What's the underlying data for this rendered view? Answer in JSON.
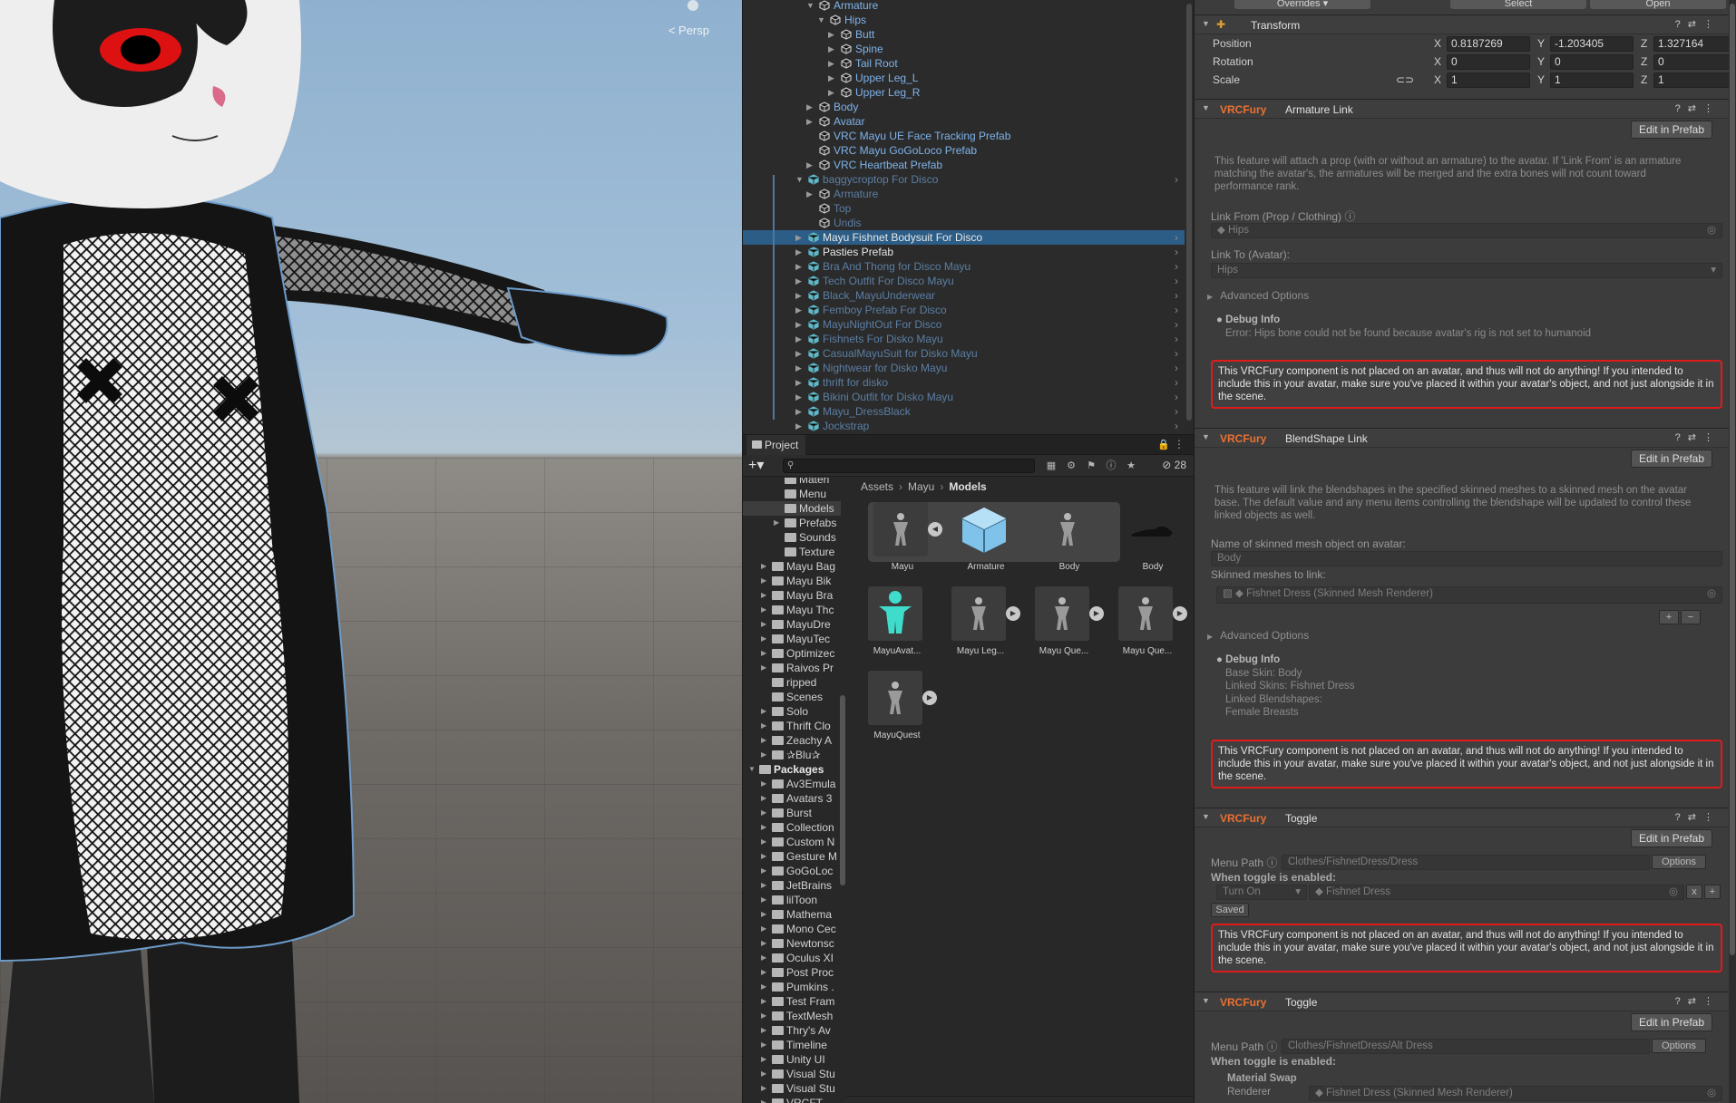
{
  "scene": {
    "camera_mode": "Persp"
  },
  "hierarchy": {
    "rows": [
      {
        "label": "Armature",
        "color": "blue"
      },
      {
        "label": "Hips",
        "color": "blue"
      },
      {
        "label": "Butt",
        "color": "blue"
      },
      {
        "label": "Spine",
        "color": "blue"
      },
      {
        "label": "Tail Root",
        "color": "blue"
      },
      {
        "label": "Upper Leg_L",
        "color": "blue"
      },
      {
        "label": "Upper Leg_R",
        "color": "blue"
      },
      {
        "label": "Body",
        "color": "blue"
      },
      {
        "label": "Avatar",
        "color": "blue"
      },
      {
        "label": "VRC Mayu UE Face Tracking Prefab",
        "color": "blue"
      },
      {
        "label": "VRC Mayu GoGoLoco Prefab",
        "color": "blue"
      },
      {
        "label": "VRC Heartbeat Prefab",
        "color": "blue"
      },
      {
        "label": "baggycroptop For Disco",
        "color": "faded"
      },
      {
        "label": "Armature",
        "color": "faded"
      },
      {
        "label": "Top",
        "color": "faded"
      },
      {
        "label": "Undis",
        "color": "faded"
      },
      {
        "label": "Mayu Fishnet Bodysuit For Disco",
        "color": "white"
      },
      {
        "label": "Pasties Prefab",
        "color": "white"
      },
      {
        "label": "Bra And Thong for Disco Mayu",
        "color": "faded"
      },
      {
        "label": "Tech Outfit For Disco Mayu",
        "color": "faded"
      },
      {
        "label": "Black_MayuUnderwear",
        "color": "faded"
      },
      {
        "label": "Femboy Prefab For Disco",
        "color": "faded"
      },
      {
        "label": "MayuNightOut For Disco",
        "color": "faded"
      },
      {
        "label": "Fishnets For Disko Mayu",
        "color": "faded"
      },
      {
        "label": "CasualMayuSuit for Disko Mayu",
        "color": "faded"
      },
      {
        "label": "Nightwear for Disko Mayu",
        "color": "faded"
      },
      {
        "label": "thrift for disko",
        "color": "faded"
      },
      {
        "label": "Bikini Outfit for Disko Mayu",
        "color": "faded"
      },
      {
        "label": "Mayu_DressBlack",
        "color": "faded"
      },
      {
        "label": "Jockstrap",
        "color": "faded"
      }
    ]
  },
  "project": {
    "tab_label": "Project",
    "hidden_count": "28",
    "breadcrumb": [
      "Assets",
      "Mayu",
      "Models"
    ],
    "tree": [
      {
        "label": "Materi"
      },
      {
        "label": "Menu"
      },
      {
        "label": "Models"
      },
      {
        "label": "Prefabs"
      },
      {
        "label": "Sounds"
      },
      {
        "label": "Texture"
      },
      {
        "label": "Mayu Bag"
      },
      {
        "label": "Mayu Bik"
      },
      {
        "label": "Mayu Bra"
      },
      {
        "label": "Mayu Thc"
      },
      {
        "label": "MayuDre"
      },
      {
        "label": "MayuTec"
      },
      {
        "label": "Optimizec"
      },
      {
        "label": "Raivos Pr"
      },
      {
        "label": "ripped"
      },
      {
        "label": "Scenes"
      },
      {
        "label": "Solo"
      },
      {
        "label": "Thrift Clo"
      },
      {
        "label": "Zeachy A"
      },
      {
        "label": "✰Blu✰"
      },
      {
        "label": "Packages"
      },
      {
        "label": "Av3Emula"
      },
      {
        "label": "Avatars 3"
      },
      {
        "label": "Burst"
      },
      {
        "label": "Collection"
      },
      {
        "label": "Custom N"
      },
      {
        "label": "Gesture M"
      },
      {
        "label": "GoGoLoc"
      },
      {
        "label": "JetBrains"
      },
      {
        "label": "lilToon"
      },
      {
        "label": "Mathema"
      },
      {
        "label": "Mono Cec"
      },
      {
        "label": "Newtonsc"
      },
      {
        "label": "Oculus XI"
      },
      {
        "label": "Post Proc"
      },
      {
        "label": "Pumkins ."
      },
      {
        "label": "Test Fram"
      },
      {
        "label": "TextMesh"
      },
      {
        "label": "Thry's Av"
      },
      {
        "label": "Timeline"
      },
      {
        "label": "Unity UI"
      },
      {
        "label": "Visual Stu"
      },
      {
        "label": "Visual Stu"
      },
      {
        "label": "VRCFT -"
      }
    ],
    "assets": [
      {
        "name": "Mayu",
        "kind": "model"
      },
      {
        "name": "Armature",
        "kind": "prefab"
      },
      {
        "name": "Body",
        "kind": "model"
      },
      {
        "name": "Body",
        "kind": "mesh"
      },
      {
        "name": "MayuAvat...",
        "kind": "avatar"
      },
      {
        "name": "Mayu Leg...",
        "kind": "model"
      },
      {
        "name": "Mayu Que...",
        "kind": "model"
      },
      {
        "name": "Mayu Que...",
        "kind": "model"
      },
      {
        "name": "MayuQuest",
        "kind": "model"
      }
    ]
  },
  "inspector": {
    "top_buttons": [
      "Overrides",
      "Select",
      "Open"
    ],
    "transform": {
      "title": "Transform",
      "position_label": "Position",
      "rotation_label": "Rotation",
      "scale_label": "Scale",
      "axis_x": "X",
      "axis_y": "Y",
      "axis_z": "Z",
      "position": [
        "0.8187269",
        "-1.203405",
        "1.327164"
      ],
      "rotation": [
        "0",
        "0",
        "0"
      ],
      "scale": [
        "1",
        "1",
        "1"
      ]
    },
    "brand": "VRCFury",
    "edit_in_prefab": "Edit in Prefab",
    "warning_text": "This VRCFury component is not placed on an avatar, and thus will not do anything! If you intended to include this in your avatar, make sure you've placed it within your avatar's object, and not just alongside it in the scene.",
    "advanced_options": "Advanced Options",
    "debug_info": "Debug Info",
    "armature_link": {
      "title": "Armature Link",
      "description": "This feature will attach a prop (with or without an armature) to the avatar. If 'Link From' is an armature matching the avatar's, the armatures will be merged and the extra bones will not count toward performance rank.",
      "link_from_label": "Link From (Prop / Clothing)",
      "link_from_value": "Hips",
      "link_to_label": "Link To (Avatar):",
      "link_to_value": "Hips",
      "debug_text": "Error: Hips bone could not be found because avatar's rig is not set to humanoid"
    },
    "blendshape_link": {
      "title": "BlendShape Link",
      "description": "This feature will link the blendshapes in the specified skinned meshes to a skinned mesh on the avatar base. The default value and any menu items controlling the blendshape will be updated to control these linked objects as well.",
      "mesh_name_label": "Name of skinned mesh object on avatar:",
      "mesh_name_value": "Body",
      "meshes_label": "Skinned meshes to link:",
      "mesh_item": "Fishnet Dress (Skinned Mesh Renderer)",
      "debug_lines": [
        "Base Skin: Body",
        "Linked Skins: Fishnet Dress",
        "Linked Blendshapes:",
        "Female Breasts"
      ]
    },
    "toggle1": {
      "title": "Toggle",
      "menu_path_label": "Menu Path",
      "menu_path": "Clothes/FishnetDress/Dress",
      "options": "Options",
      "when_enabled": "When toggle is enabled:",
      "action": "Turn On",
      "target": "Fishnet Dress",
      "saved": "Saved"
    },
    "toggle2": {
      "title": "Toggle",
      "menu_path_label": "Menu Path",
      "menu_path": "Clothes/FishnetDress/Alt Dress",
      "options": "Options",
      "when_enabled": "When toggle is enabled:",
      "material_swap": "Material Swap",
      "renderer_label": "Renderer",
      "renderer_value": "Fishnet Dress (Skinned Mesh Renderer)"
    }
  }
}
